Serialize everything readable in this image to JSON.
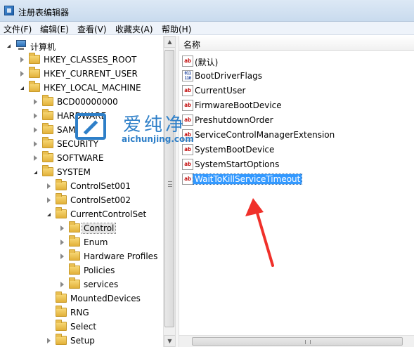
{
  "window": {
    "title": "注册表编辑器"
  },
  "menu": [
    "文件(F)",
    "编辑(E)",
    "查看(V)",
    "收藏夹(A)",
    "帮助(H)"
  ],
  "tree": [
    {
      "label": "计算机",
      "level": 0,
      "state": "expanded",
      "icon": "computer-icon"
    },
    {
      "label": "HKEY_CLASSES_ROOT",
      "level": 1,
      "state": "collapsed",
      "icon": "folder-icon"
    },
    {
      "label": "HKEY_CURRENT_USER",
      "level": 1,
      "state": "collapsed",
      "icon": "folder-icon"
    },
    {
      "label": "HKEY_LOCAL_MACHINE",
      "level": 1,
      "state": "expanded",
      "icon": "folder-icon"
    },
    {
      "label": "BCD00000000",
      "level": 2,
      "state": "collapsed",
      "icon": "folder-icon"
    },
    {
      "label": "HARDWARE",
      "level": 2,
      "state": "collapsed",
      "icon": "folder-icon"
    },
    {
      "label": "SAM",
      "level": 2,
      "state": "collapsed",
      "icon": "folder-icon"
    },
    {
      "label": "SECURITY",
      "level": 2,
      "state": "collapsed",
      "icon": "folder-icon"
    },
    {
      "label": "SOFTWARE",
      "level": 2,
      "state": "collapsed",
      "icon": "folder-icon"
    },
    {
      "label": "SYSTEM",
      "level": 2,
      "state": "expanded",
      "icon": "folder-icon"
    },
    {
      "label": "ControlSet001",
      "level": 3,
      "state": "collapsed",
      "icon": "folder-icon"
    },
    {
      "label": "ControlSet002",
      "level": 3,
      "state": "collapsed",
      "icon": "folder-icon"
    },
    {
      "label": "CurrentControlSet",
      "level": 3,
      "state": "expanded",
      "icon": "folder-icon"
    },
    {
      "label": "Control",
      "level": 4,
      "state": "collapsed",
      "icon": "folder-icon",
      "selected": true
    },
    {
      "label": "Enum",
      "level": 4,
      "state": "collapsed",
      "icon": "folder-icon"
    },
    {
      "label": "Hardware Profiles",
      "level": 4,
      "state": "collapsed",
      "icon": "folder-icon"
    },
    {
      "label": "Policies",
      "level": 4,
      "state": "none",
      "icon": "folder-icon"
    },
    {
      "label": "services",
      "level": 4,
      "state": "collapsed",
      "icon": "folder-icon"
    },
    {
      "label": "MountedDevices",
      "level": 3,
      "state": "none",
      "icon": "folder-icon"
    },
    {
      "label": "RNG",
      "level": 3,
      "state": "none",
      "icon": "folder-icon"
    },
    {
      "label": "Select",
      "level": 3,
      "state": "none",
      "icon": "folder-icon"
    },
    {
      "label": "Setup",
      "level": 3,
      "state": "collapsed",
      "icon": "folder-icon"
    }
  ],
  "list": {
    "column_name": "名称",
    "values": [
      {
        "name": "(默认)",
        "type": "string"
      },
      {
        "name": "BootDriverFlags",
        "type": "binary"
      },
      {
        "name": "CurrentUser",
        "type": "string"
      },
      {
        "name": "FirmwareBootDevice",
        "type": "string"
      },
      {
        "name": "PreshutdownOrder",
        "type": "string"
      },
      {
        "name": "ServiceControlManagerExtension",
        "type": "string"
      },
      {
        "name": "SystemBootDevice",
        "type": "string"
      },
      {
        "name": "SystemStartOptions",
        "type": "string"
      },
      {
        "name": "WaitToKillServiceTimeout",
        "type": "string",
        "selected": true
      }
    ]
  },
  "icon_glyphs": {
    "string": "ab",
    "binary": "011\n110"
  },
  "watermark": {
    "text": "爱纯净",
    "url": "aichunjing.com"
  },
  "colors": {
    "selection": "#3399ff",
    "arrow": "#f0302a",
    "watermark": "#2e7fc8"
  }
}
